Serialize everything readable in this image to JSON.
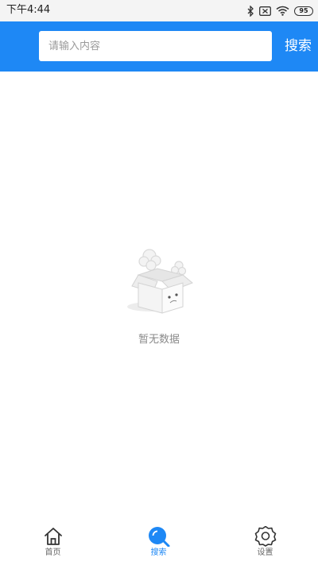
{
  "status_bar": {
    "time": "下午4:44",
    "battery": "95",
    "icons": [
      "bluetooth-icon",
      "sim-off-icon",
      "wifi-icon",
      "battery-icon"
    ]
  },
  "header": {
    "search_placeholder": "请输入内容",
    "search_value": "",
    "search_button_label": "搜索"
  },
  "empty_state": {
    "message": "暂无数据",
    "icon": "empty-box-icon"
  },
  "tab_bar": {
    "active_index": 1,
    "items": [
      {
        "label": "首页",
        "icon": "home-icon"
      },
      {
        "label": "搜索",
        "icon": "search-icon"
      },
      {
        "label": "设置",
        "icon": "settings-gear-icon"
      }
    ]
  },
  "colors": {
    "primary": "#1e88f5",
    "status_bar_bg": "#f4f4f4",
    "muted_text": "#8a8a8a"
  }
}
